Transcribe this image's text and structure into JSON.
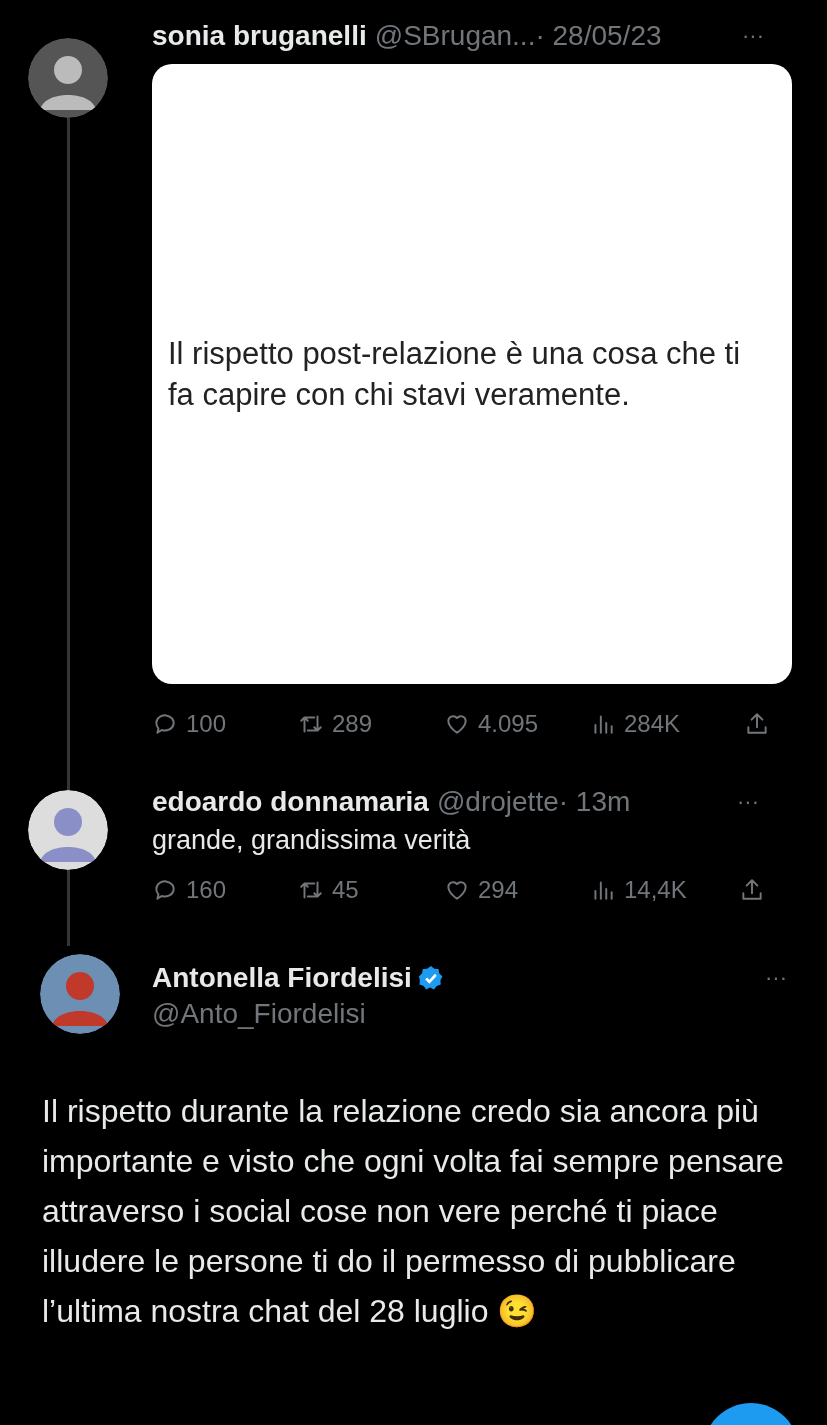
{
  "parent_tweet": {
    "name": "sonia bruganelli",
    "handle": "@SBrugan...",
    "time": "· 28/05/23",
    "more": "···",
    "image_text": "Il rispetto post-relazione è una cosa che ti fa capire con chi stavi veramente.",
    "stats": [
      {
        "kind": "reply",
        "value": "100"
      },
      {
        "kind": "retweet",
        "value": "289"
      },
      {
        "kind": "like",
        "value": "4.095"
      },
      {
        "kind": "views",
        "value": "284K"
      },
      {
        "kind": "share"
      }
    ]
  },
  "reply_tweet": {
    "name": "edoardo donnamaria",
    "handle": "@drojette",
    "time": "· 13m",
    "more": "···",
    "text": "grande, grandissima verità",
    "stats": [
      {
        "kind": "reply",
        "value": "160"
      },
      {
        "kind": "retweet",
        "value": "45"
      },
      {
        "kind": "like",
        "value": "294"
      },
      {
        "kind": "views",
        "value": "14,4K"
      },
      {
        "kind": "share"
      }
    ]
  },
  "main_tweet": {
    "name": "Antonella Fiordelisi",
    "verified": true,
    "handle": "@Anto_Fiordelisi",
    "more": "···",
    "text": "Il rispetto durante la relazione credo sia ancora più importante e visto che ogni volta fai sempre pensare attraverso i social cose non vere perché ti piace illudere le persone ti do il permesso di pubblicare l’ultima nostra chat del 28 luglio 😉"
  }
}
